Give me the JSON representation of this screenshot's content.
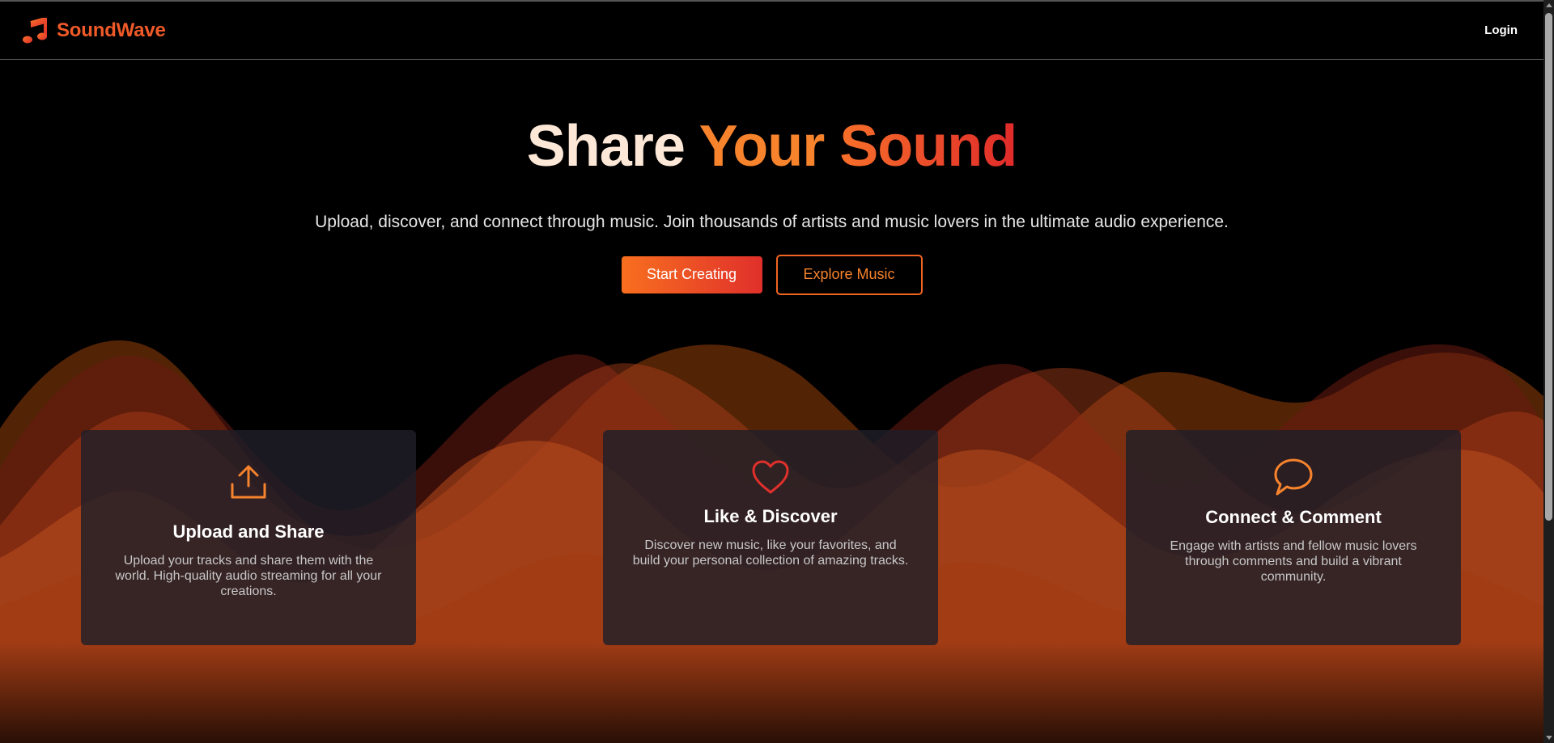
{
  "brand": {
    "name": "SoundWave",
    "icon": "music-note-icon",
    "color": "#f05a28"
  },
  "nav": {
    "login_label": "Login"
  },
  "hero": {
    "title_word_1": "Share",
    "title_word_2": "Your",
    "title_word_3": "Sound",
    "subtitle": "Upload, discover, and connect through music. Join thousands of artists and music lovers in the ultimate audio experience.",
    "primary_cta_label": "Start Creating",
    "secondary_cta_label": "Explore Music"
  },
  "features": [
    {
      "icon": "upload-icon",
      "title": "Upload and Share",
      "description": "Upload your tracks and share them with the world. High-quality audio streaming for all your creations."
    },
    {
      "icon": "heart-icon",
      "title": "Like & Discover",
      "description": "Discover new music, like your favorites, and build your personal collection of amazing tracks."
    },
    {
      "icon": "chat-bubble-icon",
      "title": "Connect & Comment",
      "description": "Engage with artists and fellow music lovers through comments and build a vibrant community."
    }
  ],
  "colors": {
    "accent_orange": "#f7832c",
    "accent_red": "#e0302b",
    "background": "#000000",
    "card_bg": "#201e28"
  }
}
